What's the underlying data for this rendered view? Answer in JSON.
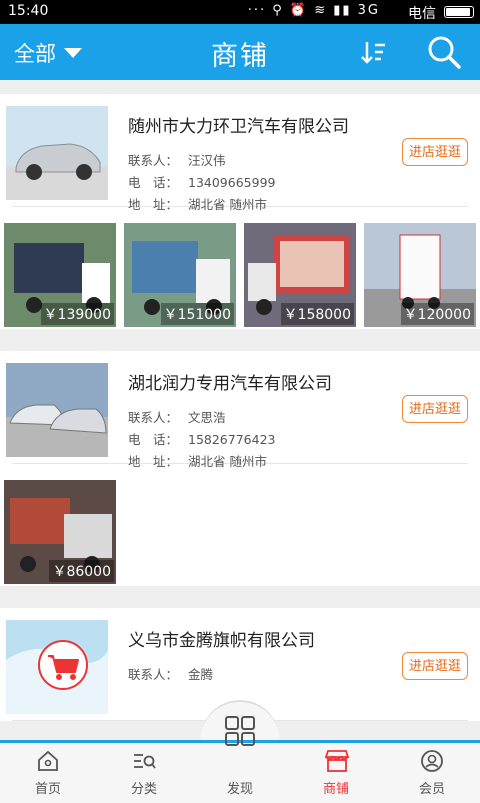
{
  "status": {
    "time": "15:40",
    "carrier": "电信",
    "icons": "··· ⚲ ⏰ ≋ ▮▮ 3G"
  },
  "header": {
    "filter_label": "全部",
    "title": "商铺"
  },
  "shops": [
    {
      "name": "随州市大力环卫汽车有限公司",
      "contact_label": "联系人：",
      "contact": "汪汉伟",
      "phone_label": "电　话：",
      "phone": "13409665999",
      "address_label": "地　址：",
      "address": "湖北省 随州市",
      "button": "进店逛逛",
      "products": [
        {
          "price": "￥139000",
          "color": "#6d8b6a"
        },
        {
          "price": "￥151000",
          "color": "#7a9b86"
        },
        {
          "price": "￥158000",
          "color": "#6f6b7a"
        },
        {
          "price": "￥120000",
          "color": "#b9c7d6"
        }
      ]
    },
    {
      "name": "湖北润力专用汽车有限公司",
      "contact_label": "联系人：",
      "contact": "文思浩",
      "phone_label": "电　话：",
      "phone": "15826776423",
      "address_label": "地　址：",
      "address": "湖北省 随州市",
      "button": "进店逛逛",
      "products": [
        {
          "price": "￥86000",
          "color": "#5c4a46"
        }
      ]
    },
    {
      "name": "义乌市金腾旗帜有限公司",
      "contact_label": "联系人：",
      "contact": "金腾",
      "button": "进店逛逛"
    }
  ],
  "nav": [
    {
      "label": "首页",
      "icon": "home-icon"
    },
    {
      "label": "分类",
      "icon": "category-icon"
    },
    {
      "label": "发现",
      "icon": "discover-icon"
    },
    {
      "label": "商铺",
      "icon": "shop-icon",
      "active": true
    },
    {
      "label": "会员",
      "icon": "member-icon"
    }
  ],
  "colors": {
    "accent": "#1aa1e7",
    "button": "#e66a1a",
    "active_nav": "#e33333"
  }
}
